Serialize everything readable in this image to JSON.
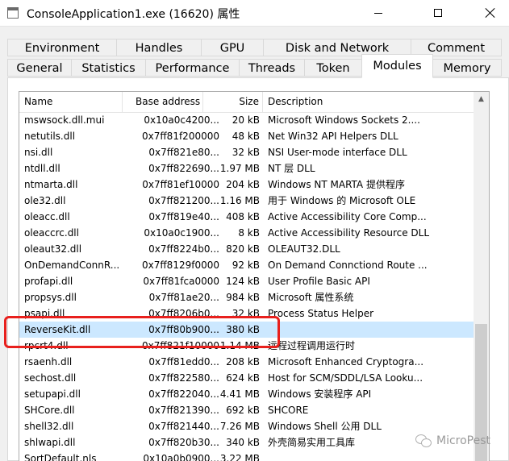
{
  "window": {
    "title": "ConsoleApplication1.exe (16620) 属性"
  },
  "tabs_top": [
    "Environment",
    "Handles",
    "GPU",
    "Disk and Network",
    "Comment"
  ],
  "tabs_bottom": [
    "General",
    "Statistics",
    "Performance",
    "Threads",
    "Token",
    "Modules",
    "Memory"
  ],
  "active_tab": "Modules",
  "columns": {
    "name": "Name",
    "base": "Base address",
    "size": "Size",
    "desc": "Description"
  },
  "rows": [
    {
      "name": "mswsock.dll.mui",
      "base": "0x10a0c4200...",
      "size": "20 kB",
      "desc": "Microsoft Windows Sockets 2...."
    },
    {
      "name": "netutils.dll",
      "base": "0x7ff81f200000",
      "size": "48 kB",
      "desc": "Net Win32 API Helpers DLL"
    },
    {
      "name": "nsi.dll",
      "base": "0x7ff821e80...",
      "size": "32 kB",
      "desc": "NSI User-mode interface DLL"
    },
    {
      "name": "ntdll.dll",
      "base": "0x7ff822690...",
      "size": "1.97 MB",
      "desc": "NT 层 DLL"
    },
    {
      "name": "ntmarta.dll",
      "base": "0x7ff81ef10000",
      "size": "204 kB",
      "desc": "Windows NT MARTA 提供程序"
    },
    {
      "name": "ole32.dll",
      "base": "0x7ff821200...",
      "size": "1.16 MB",
      "desc": "用于 Windows 的 Microsoft OLE"
    },
    {
      "name": "oleacc.dll",
      "base": "0x7ff819e40...",
      "size": "408 kB",
      "desc": "Active Accessibility Core Comp..."
    },
    {
      "name": "oleaccrc.dll",
      "base": "0x10a0c1900...",
      "size": "8 kB",
      "desc": "Active Accessibility Resource DLL"
    },
    {
      "name": "oleaut32.dll",
      "base": "0x7ff8224b0...",
      "size": "820 kB",
      "desc": "OLEAUT32.DLL"
    },
    {
      "name": "OnDemandConnR...",
      "base": "0x7ff8129f0000",
      "size": "92 kB",
      "desc": "On Demand Connctiond Route ..."
    },
    {
      "name": "profapi.dll",
      "base": "0x7ff81fca0000",
      "size": "124 kB",
      "desc": "User Profile Basic API"
    },
    {
      "name": "propsys.dll",
      "base": "0x7ff81ae20...",
      "size": "984 kB",
      "desc": "Microsoft 属性系统"
    },
    {
      "name": "psapi.dll",
      "base": "0x7ff8206b0...",
      "size": "32 kB",
      "desc": "Process Status Helper"
    },
    {
      "name": "ReverseKit.dll",
      "base": "0x7ff80b900...",
      "size": "380 kB",
      "desc": "",
      "selected": true
    },
    {
      "name": "rpcrt4.dll",
      "base": "0x7ff821f10000",
      "size": "1.14 MB",
      "desc": "远程过程调用运行时"
    },
    {
      "name": "rsaenh.dll",
      "base": "0x7ff81edd0...",
      "size": "208 kB",
      "desc": "Microsoft Enhanced Cryptogra..."
    },
    {
      "name": "sechost.dll",
      "base": "0x7ff822580...",
      "size": "624 kB",
      "desc": "Host for SCM/SDDL/LSA Looku..."
    },
    {
      "name": "setupapi.dll",
      "base": "0x7ff822040...",
      "size": "4.41 MB",
      "desc": "Windows 安装程序 API"
    },
    {
      "name": "SHCore.dll",
      "base": "0x7ff821390...",
      "size": "692 kB",
      "desc": "SHCORE"
    },
    {
      "name": "shell32.dll",
      "base": "0x7ff821440...",
      "size": "7.26 MB",
      "desc": "Windows Shell 公用 DLL"
    },
    {
      "name": "shlwapi.dll",
      "base": "0x7ff820b30...",
      "size": "340 kB",
      "desc": "外壳简易实用工具库"
    },
    {
      "name": "SortDefault.nls",
      "base": "0x10a0b0900...",
      "size": "3.22 MB",
      "desc": ""
    }
  ],
  "watermark": "MicroPest",
  "colors": {
    "selection": "#cce8ff",
    "annotation_box": "#e8201d"
  }
}
